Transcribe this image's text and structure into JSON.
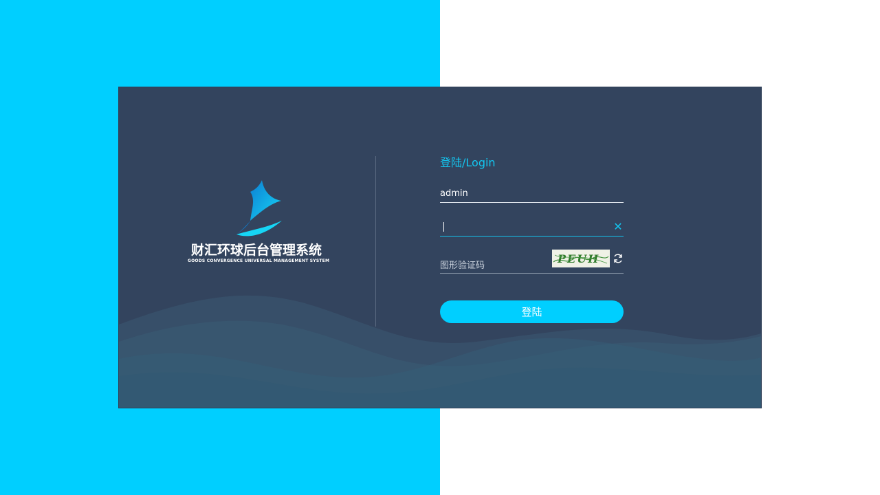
{
  "brand": {
    "title": "财汇环球后台管理系统",
    "subtitle": "GOODS CONVERGENCE UNIVERSAL MANAGEMENT SYSTEM"
  },
  "login": {
    "title": "登陆/Login",
    "username_value": "admin",
    "password_value": "",
    "captcha_placeholder": "图形验证码",
    "captcha_text": "PEUH",
    "submit_label": "登陆"
  },
  "colors": {
    "left_background": "#00cfff",
    "right_background": "#ffffff",
    "card_background": "#33445e",
    "accent": "#13c6f0"
  },
  "icons": {
    "clear": "close-icon",
    "refresh": "refresh-icon"
  }
}
